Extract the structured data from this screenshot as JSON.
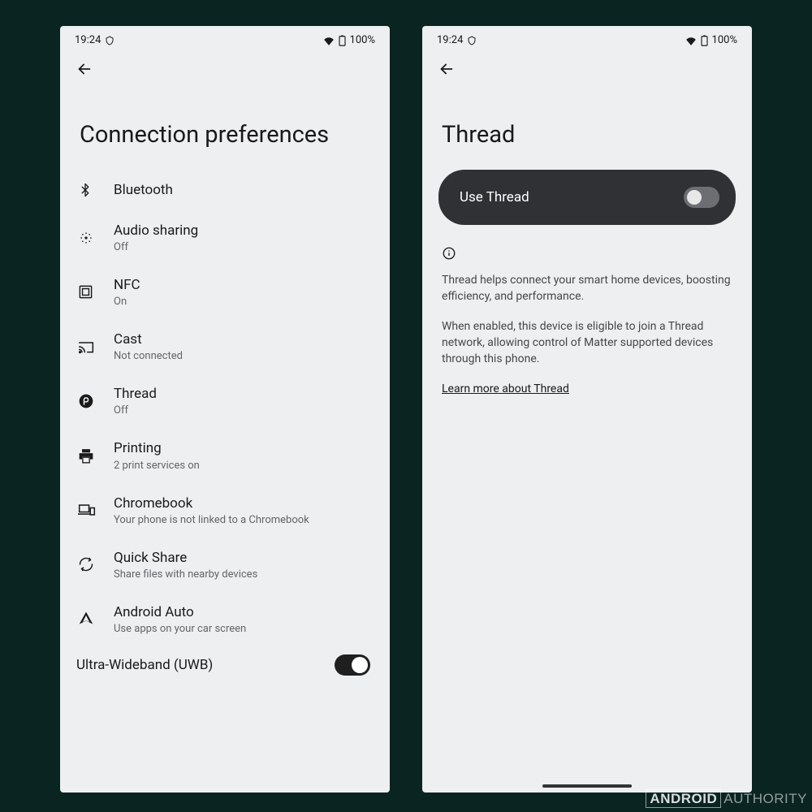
{
  "status": {
    "time": "19:24",
    "battery": "100%"
  },
  "left": {
    "title": "Connection preferences",
    "items": [
      {
        "icon": "bluetooth",
        "title": "Bluetooth",
        "sub": ""
      },
      {
        "icon": "audio-sharing",
        "title": "Audio sharing",
        "sub": "Off"
      },
      {
        "icon": "nfc",
        "title": "NFC",
        "sub": "On"
      },
      {
        "icon": "cast",
        "title": "Cast",
        "sub": "Not connected"
      },
      {
        "icon": "thread",
        "title": "Thread",
        "sub": "Off"
      },
      {
        "icon": "print",
        "title": "Printing",
        "sub": "2 print services on"
      },
      {
        "icon": "chromebook",
        "title": "Chromebook",
        "sub": "Your phone is not linked to a Chromebook"
      },
      {
        "icon": "quick-share",
        "title": "Quick Share",
        "sub": "Share files with nearby devices"
      },
      {
        "icon": "android-auto",
        "title": "Android Auto",
        "sub": "Use apps on your car screen"
      }
    ],
    "uwb": {
      "title": "Ultra-Wideband (UWB)"
    }
  },
  "right": {
    "title": "Thread",
    "toggle_label": "Use Thread",
    "info1": "Thread helps connect your smart home devices, boosting efficiency, and performance.",
    "info2": "When enabled, this device is eligible to join a Thread network, allowing control of Matter supported devices through this phone.",
    "learn_more": "Learn more about Thread"
  },
  "watermark": {
    "bold": "ANDROID",
    "light": "AUTHORITY"
  }
}
